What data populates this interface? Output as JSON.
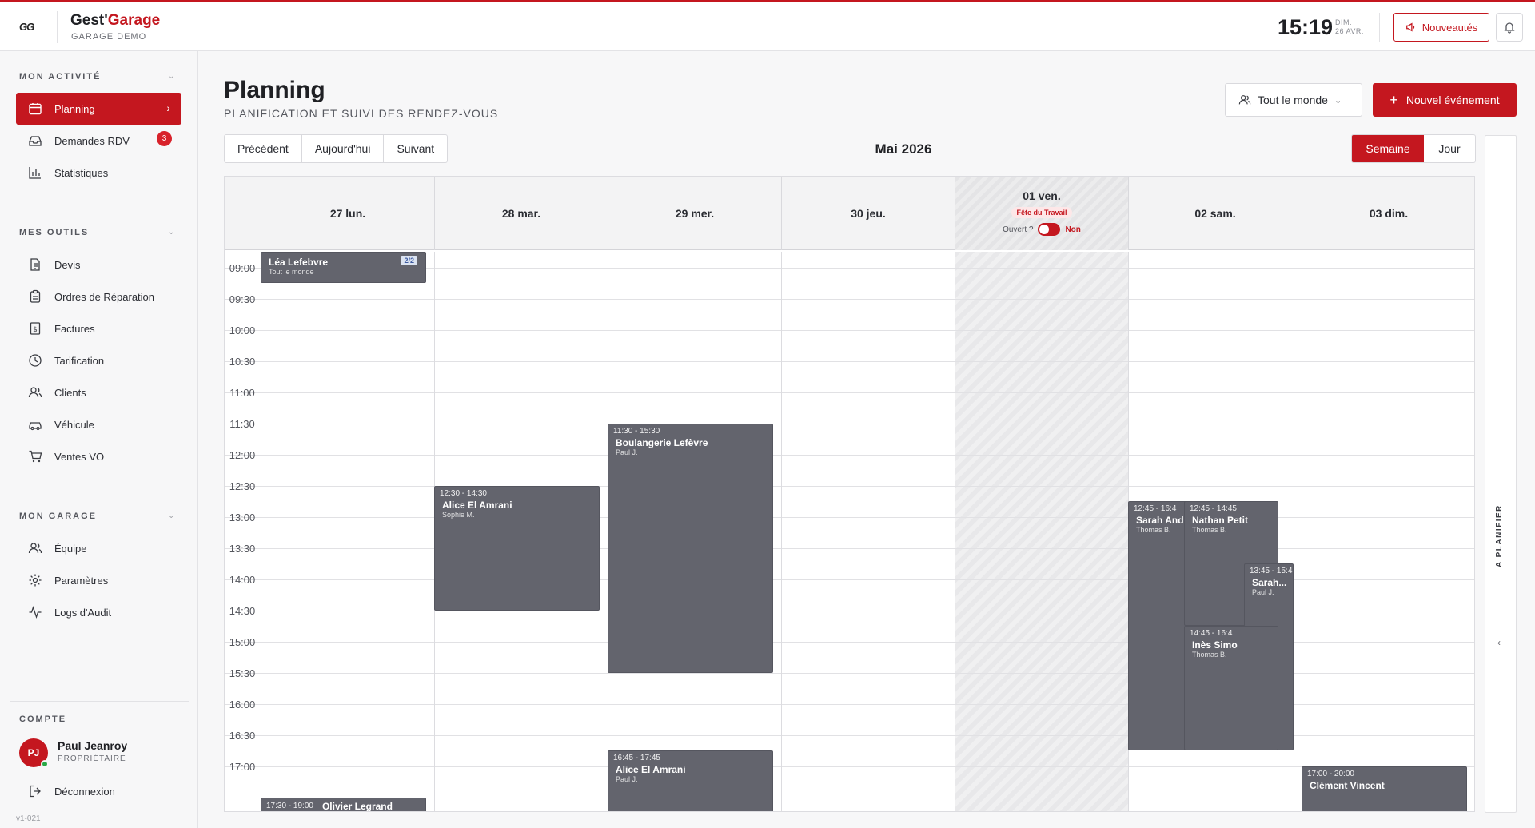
{
  "header": {
    "logo_text": "GG",
    "brand_main": "Gest'",
    "brand_accent": "Garage",
    "brand_sub": "GARAGE DEMO",
    "clock": "15:19",
    "clock_day": "DIM.",
    "clock_date": "26 AVR.",
    "news_label": "Nouveautés"
  },
  "sidebar": {
    "sections": [
      {
        "title": "MON ACTIVITÉ",
        "items": [
          {
            "label": "Planning",
            "icon": "calendar-icon",
            "active": true
          },
          {
            "label": "Demandes RDV",
            "icon": "inbox-icon",
            "badge": "3"
          },
          {
            "label": "Statistiques",
            "icon": "bar-chart-icon"
          }
        ]
      },
      {
        "title": "MES OUTILS",
        "items": [
          {
            "label": "Devis",
            "icon": "document-icon"
          },
          {
            "label": "Ordres de Réparation",
            "icon": "clipboard-icon"
          },
          {
            "label": "Factures",
            "icon": "invoice-icon"
          },
          {
            "label": "Tarification",
            "icon": "clock-icon"
          },
          {
            "label": "Clients",
            "icon": "users-icon"
          },
          {
            "label": "Véhicule",
            "icon": "car-icon"
          },
          {
            "label": "Ventes VO",
            "icon": "cart-icon"
          }
        ]
      },
      {
        "title": "MON GARAGE",
        "items": [
          {
            "label": "Équipe",
            "icon": "team-icon"
          },
          {
            "label": "Paramètres",
            "icon": "gear-icon"
          },
          {
            "label": "Logs d'Audit",
            "icon": "activity-icon"
          }
        ]
      }
    ],
    "account_title": "COMPTE",
    "user_initials": "PJ",
    "user_name": "Paul Jeanroy",
    "user_role": "PROPRIÉTAIRE",
    "logout_label": "Déconnexion",
    "version": "v1-021"
  },
  "page": {
    "title": "Planning",
    "subtitle": "PLANIFICATION ET SUIVI DES RENDEZ-VOUS",
    "people_filter": "Tout le monde",
    "new_event_label": "Nouvel événement",
    "prev_label": "Précédent",
    "today_label": "Aujourd'hui",
    "next_label": "Suivant",
    "month": "Mai 2026",
    "view_week": "Semaine",
    "view_day": "Jour",
    "side_panel_label": "A PLANIFIER"
  },
  "calendar": {
    "days": [
      {
        "label": "27 lun."
      },
      {
        "label": "28 mar."
      },
      {
        "label": "29 mer."
      },
      {
        "label": "30 jeu."
      },
      {
        "label": "01 ven.",
        "holiday": "Fête du Travail",
        "open_question": "Ouvert ?",
        "open_value": "Non"
      },
      {
        "label": "02 sam."
      },
      {
        "label": "03 dim."
      }
    ],
    "hours": [
      "09:00",
      "09:30",
      "10:00",
      "10:30",
      "11:00",
      "11:30",
      "12:00",
      "12:30",
      "13:00",
      "13:30",
      "14:00",
      "14:30",
      "15:00",
      "15:30",
      "16:00",
      "16:30",
      "17:00"
    ],
    "events": [
      {
        "day": 0,
        "start": "08:15",
        "end": "09:15",
        "time": "",
        "name": "Léa Lefebvre",
        "who": "Tout le monde",
        "tag": "2/2"
      },
      {
        "day": 0,
        "start": "17:30",
        "end": "19:00",
        "time": "17:30 - 19:00",
        "name": "Olivier Legrand",
        "who": "",
        "inline": true
      },
      {
        "day": 1,
        "start": "12:30",
        "end": "14:30",
        "time": "12:30 - 14:30",
        "name": "Alice El Amrani",
        "who": "Sophie M."
      },
      {
        "day": 2,
        "start": "11:30",
        "end": "15:30",
        "time": "11:30 - 15:30",
        "name": "Boulangerie Lefèvre",
        "who": "Paul J."
      },
      {
        "day": 2,
        "start": "16:45",
        "end": "17:45",
        "time": "16:45 - 17:45",
        "name": "Alice El Amrani",
        "who": "Paul J."
      },
      {
        "day": 5,
        "start": "12:45",
        "end": "16:45",
        "time": "12:45 - 16:4",
        "name": "Sarah And",
        "who": "Thomas B.",
        "lane": 0
      },
      {
        "day": 5,
        "start": "12:45",
        "end": "14:45",
        "time": "12:45 - 14:45",
        "name": "Nathan Petit",
        "who": "Thomas B.",
        "lane": 1
      },
      {
        "day": 5,
        "start": "13:45",
        "end": "16:45",
        "time": "13:45 - 15:4",
        "name": "Sarah...",
        "who": "Paul J.",
        "lane": 2
      },
      {
        "day": 5,
        "start": "14:45",
        "end": "16:45",
        "time": "14:45 - 16:4",
        "name": "Inès Simo",
        "who": "Thomas B.",
        "lane": 1
      },
      {
        "day": 6,
        "start": "17:00",
        "end": "20:00",
        "time": "17:00 - 20:00",
        "name": "Clément Vincent",
        "who": ""
      }
    ]
  }
}
